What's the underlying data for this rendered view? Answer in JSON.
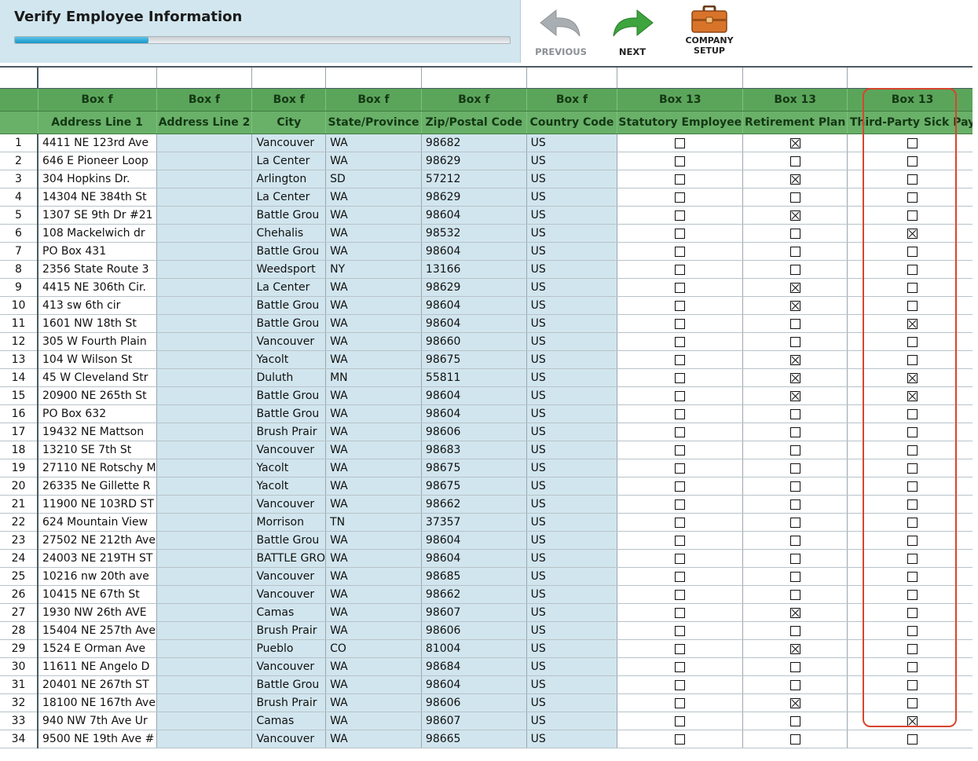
{
  "title": "Verify Employee Information",
  "progress": 0.27,
  "toolbar": {
    "previous": {
      "label": "PREVIOUS",
      "icon": "back-arrow-icon",
      "enabled": false
    },
    "next": {
      "label": "NEXT",
      "icon": "forward-arrow-icon",
      "enabled": true
    },
    "company": {
      "label_line1": "COMPANY",
      "label_line2": "SETUP",
      "icon": "briefcase-icon"
    }
  },
  "columns": [
    {
      "box": "Box f",
      "header": "Address Line 1"
    },
    {
      "box": "Box f",
      "header": "Address Line 2"
    },
    {
      "box": "Box f",
      "header": "City"
    },
    {
      "box": "Box f",
      "header": "State/Province"
    },
    {
      "box": "Box f",
      "header": "Zip/Postal Code"
    },
    {
      "box": "Box f",
      "header": "Country Code"
    },
    {
      "box": "Box 13",
      "header": "Statutory Employee"
    },
    {
      "box": "Box 13",
      "header": "Retirement Plan"
    },
    {
      "box": "Box 13",
      "header": "Third-Party Sick Pay"
    }
  ],
  "rows": [
    [
      "1",
      "4411 NE 123rd Ave",
      "",
      "Vancouver",
      "WA",
      "98682",
      "US",
      false,
      true,
      false
    ],
    [
      "2",
      "646 E Pioneer Loop",
      "",
      "La Center",
      "WA",
      "98629",
      "US",
      false,
      false,
      false
    ],
    [
      "3",
      "304 Hopkins Dr.",
      "",
      "Arlington",
      "SD",
      "57212",
      "US",
      false,
      true,
      false
    ],
    [
      "4",
      "14304 NE 384th St",
      "",
      "La Center",
      "WA",
      "98629",
      "US",
      false,
      false,
      false
    ],
    [
      "5",
      "1307 SE 9th Dr #21",
      "",
      "Battle Grou",
      "WA",
      "98604",
      "US",
      false,
      true,
      false
    ],
    [
      "6",
      "108 Mackelwich dr",
      "",
      "Chehalis",
      "WA",
      "98532",
      "US",
      false,
      false,
      true
    ],
    [
      "7",
      "PO Box 431",
      "",
      "Battle Grou",
      "WA",
      "98604",
      "US",
      false,
      false,
      false
    ],
    [
      "8",
      "2356 State Route 3",
      "",
      "Weedsport",
      "NY",
      "13166",
      "US",
      false,
      false,
      false
    ],
    [
      "9",
      "4415 NE 306th Cir.",
      "",
      "La Center",
      "WA",
      "98629",
      "US",
      false,
      true,
      false
    ],
    [
      "10",
      "413 sw 6th cir",
      "",
      "Battle Grou",
      "WA",
      "98604",
      "US",
      false,
      true,
      false
    ],
    [
      "11",
      "1601 NW 18th St",
      "",
      "Battle Grou",
      "WA",
      "98604",
      "US",
      false,
      false,
      true
    ],
    [
      "12",
      "305 W Fourth Plain",
      "",
      "Vancouver",
      "WA",
      "98660",
      "US",
      false,
      false,
      false
    ],
    [
      "13",
      "104 W Wilson St",
      "",
      "Yacolt",
      "WA",
      "98675",
      "US",
      false,
      true,
      false
    ],
    [
      "14",
      "45 W Cleveland Str",
      "",
      "Duluth",
      "MN",
      "55811",
      "US",
      false,
      true,
      true
    ],
    [
      "15",
      "20900 NE 265th St",
      "",
      "Battle Grou",
      "WA",
      "98604",
      "US",
      false,
      true,
      true
    ],
    [
      "16",
      "PO Box 632",
      "",
      "Battle Grou",
      "WA",
      "98604",
      "US",
      false,
      false,
      false
    ],
    [
      "17",
      "19432 NE Mattson",
      "",
      "Brush Prair",
      "WA",
      "98606",
      "US",
      false,
      false,
      false
    ],
    [
      "18",
      "13210 SE 7th St",
      "",
      "Vancouver",
      "WA",
      "98683",
      "US",
      false,
      false,
      false
    ],
    [
      "19",
      "27110 NE Rotschy M",
      "",
      "Yacolt",
      "WA",
      "98675",
      "US",
      false,
      false,
      false
    ],
    [
      "20",
      "26335 Ne Gillette R",
      "",
      "Yacolt",
      "WA",
      "98675",
      "US",
      false,
      false,
      false
    ],
    [
      "21",
      "11900 NE 103RD ST",
      "",
      "Vancouver",
      "WA",
      "98662",
      "US",
      false,
      false,
      false
    ],
    [
      "22",
      "624 Mountain View",
      "",
      "Morrison",
      "TN",
      "37357",
      "US",
      false,
      false,
      false
    ],
    [
      "23",
      "27502 NE 212th Ave",
      "",
      "Battle Grou",
      "WA",
      "98604",
      "US",
      false,
      false,
      false
    ],
    [
      "24",
      "24003 NE 219TH ST",
      "",
      "BATTLE GRO",
      "WA",
      "98604",
      "US",
      false,
      false,
      false
    ],
    [
      "25",
      "10216 nw 20th ave",
      "",
      "Vancouver",
      "WA",
      "98685",
      "US",
      false,
      false,
      false
    ],
    [
      "26",
      "10415 NE 67th St",
      "",
      "Vancouver",
      "WA",
      "98662",
      "US",
      false,
      false,
      false
    ],
    [
      "27",
      "1930 NW 26th AVE",
      "",
      "Camas",
      "WA",
      "98607",
      "US",
      false,
      true,
      false
    ],
    [
      "28",
      "15404 NE 257th Ave",
      "",
      "Brush Prair",
      "WA",
      "98606",
      "US",
      false,
      false,
      false
    ],
    [
      "29",
      "1524 E Orman Ave",
      "",
      "Pueblo",
      "CO",
      "81004",
      "US",
      false,
      true,
      false
    ],
    [
      "30",
      "11611 NE Angelo D",
      "",
      "Vancouver",
      "WA",
      "98684",
      "US",
      false,
      false,
      false
    ],
    [
      "31",
      "20401 NE 267th ST",
      "",
      "Battle Grou",
      "WA",
      "98604",
      "US",
      false,
      false,
      false
    ],
    [
      "32",
      "18100 NE 167th Ave",
      "",
      "Brush Prair",
      "WA",
      "98606",
      "US",
      false,
      true,
      false
    ],
    [
      "33",
      "940 NW 7th Ave Ur",
      "",
      "Camas",
      "WA",
      "98607",
      "US",
      false,
      false,
      true
    ],
    [
      "34",
      "9500 NE 19th Ave #",
      "",
      "Vancouver",
      "WA",
      "98665",
      "US",
      false,
      false,
      false
    ]
  ]
}
